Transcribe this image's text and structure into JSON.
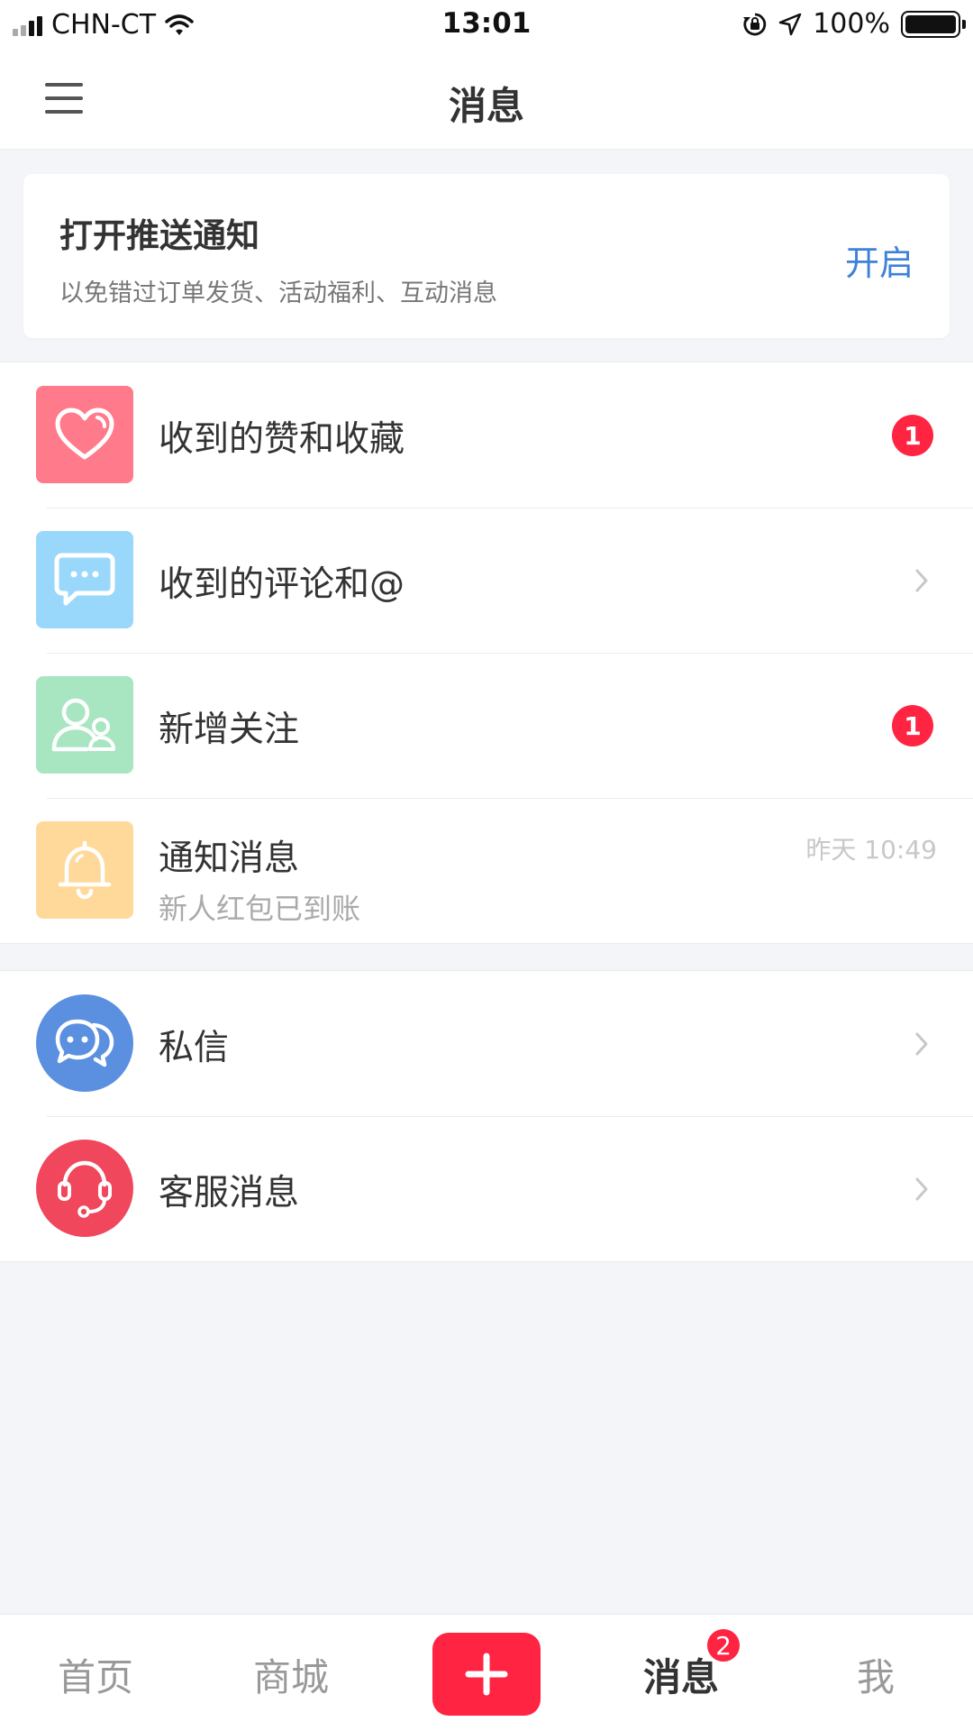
{
  "status_bar": {
    "carrier": "CHN-CT",
    "time": "13:01",
    "battery": "100%"
  },
  "header": {
    "title": "消息",
    "menu_icon": "hamburger-menu-icon"
  },
  "push_card": {
    "title": "打开推送通知",
    "subtitle": "以免错过订单发货、活动福利、互动消息",
    "action": "开启"
  },
  "notifications": [
    {
      "label": "收到的赞和收藏",
      "icon": "heart-icon",
      "color": "#ff7a8a",
      "badge": "1"
    },
    {
      "label": "收到的评论和@",
      "icon": "comment-bubble-icon",
      "color": "#9ad8fb"
    },
    {
      "label": "新增关注",
      "icon": "user-follow-icon",
      "color": "#a8e6c2",
      "badge": "1"
    },
    {
      "label": "通知消息",
      "icon": "bell-icon",
      "color": "#ffd99a",
      "subtitle": "新人红包已到账",
      "time": "昨天 10:49"
    }
  ],
  "messages": [
    {
      "label": "私信",
      "icon": "chat-bubbles-icon",
      "color": "#5b8fe0"
    },
    {
      "label": "客服消息",
      "icon": "headset-icon",
      "color": "#f0475d"
    }
  ],
  "tabbar": {
    "home": "首页",
    "mall": "商城",
    "messages": "消息",
    "messages_badge": "2",
    "me": "我",
    "accent": "#ff2442"
  }
}
